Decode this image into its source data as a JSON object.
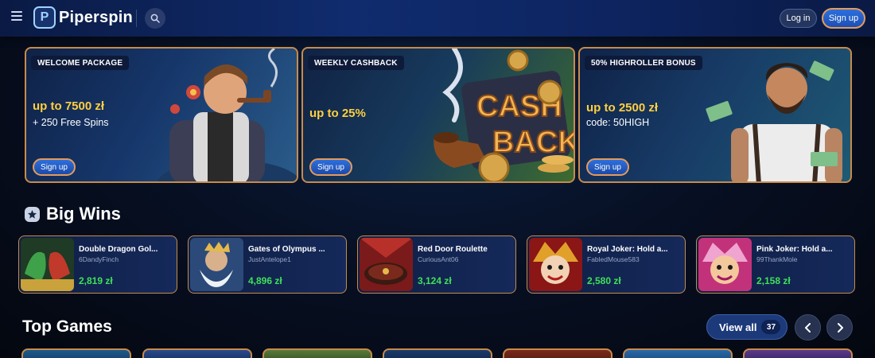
{
  "header": {
    "logo_mark": "P",
    "logo_text": "Piperspin",
    "login_label": "Log in",
    "signup_label": "Sign up",
    "icons": [
      "menu-icon",
      "search-icon"
    ]
  },
  "promos": [
    {
      "tag": "WELCOME PACKAGE",
      "amount": "up to 7500 zł",
      "sub": "+ 250 Free Spins",
      "button": "Sign up"
    },
    {
      "tag": "WEEKLY CASHBACK",
      "amount": "up to 25%",
      "sub": "",
      "button": "Sign up",
      "art_text_1": "CASH",
      "art_text_2": "BACK"
    },
    {
      "tag": "50% HIGHROLLER BONUS",
      "amount": "up to 2500 zł",
      "sub": "code: 50HIGH",
      "button": "Sign up"
    }
  ],
  "big_wins": {
    "title": "Big Wins",
    "icon": "star-icon",
    "items": [
      {
        "game": "Double Dragon Gol...",
        "user": "6DandyFinch",
        "amount": "2,819 zł"
      },
      {
        "game": "Gates of Olympus ...",
        "user": "JustAntelope1",
        "amount": "4,896 zł"
      },
      {
        "game": "Red Door Roulette",
        "user": "CuriousAnt06",
        "amount": "3,124 zł"
      },
      {
        "game": "Royal Joker: Hold a...",
        "user": "FabledMouse583",
        "amount": "2,580 zł"
      },
      {
        "game": "Pink Joker: Hold a...",
        "user": "99ThankMole",
        "amount": "2,158 zł"
      }
    ]
  },
  "top_games": {
    "title": "Top Games",
    "view_all_label": "View all",
    "view_all_count": "37",
    "icons": [
      "chevron-left-icon",
      "chevron-right-icon"
    ]
  },
  "colors": {
    "accent_blue": "#1d4fb4",
    "accent_gold": "#c78b4a",
    "amount_yellow": "#ffcf3f",
    "win_green": "#3fe05a"
  }
}
